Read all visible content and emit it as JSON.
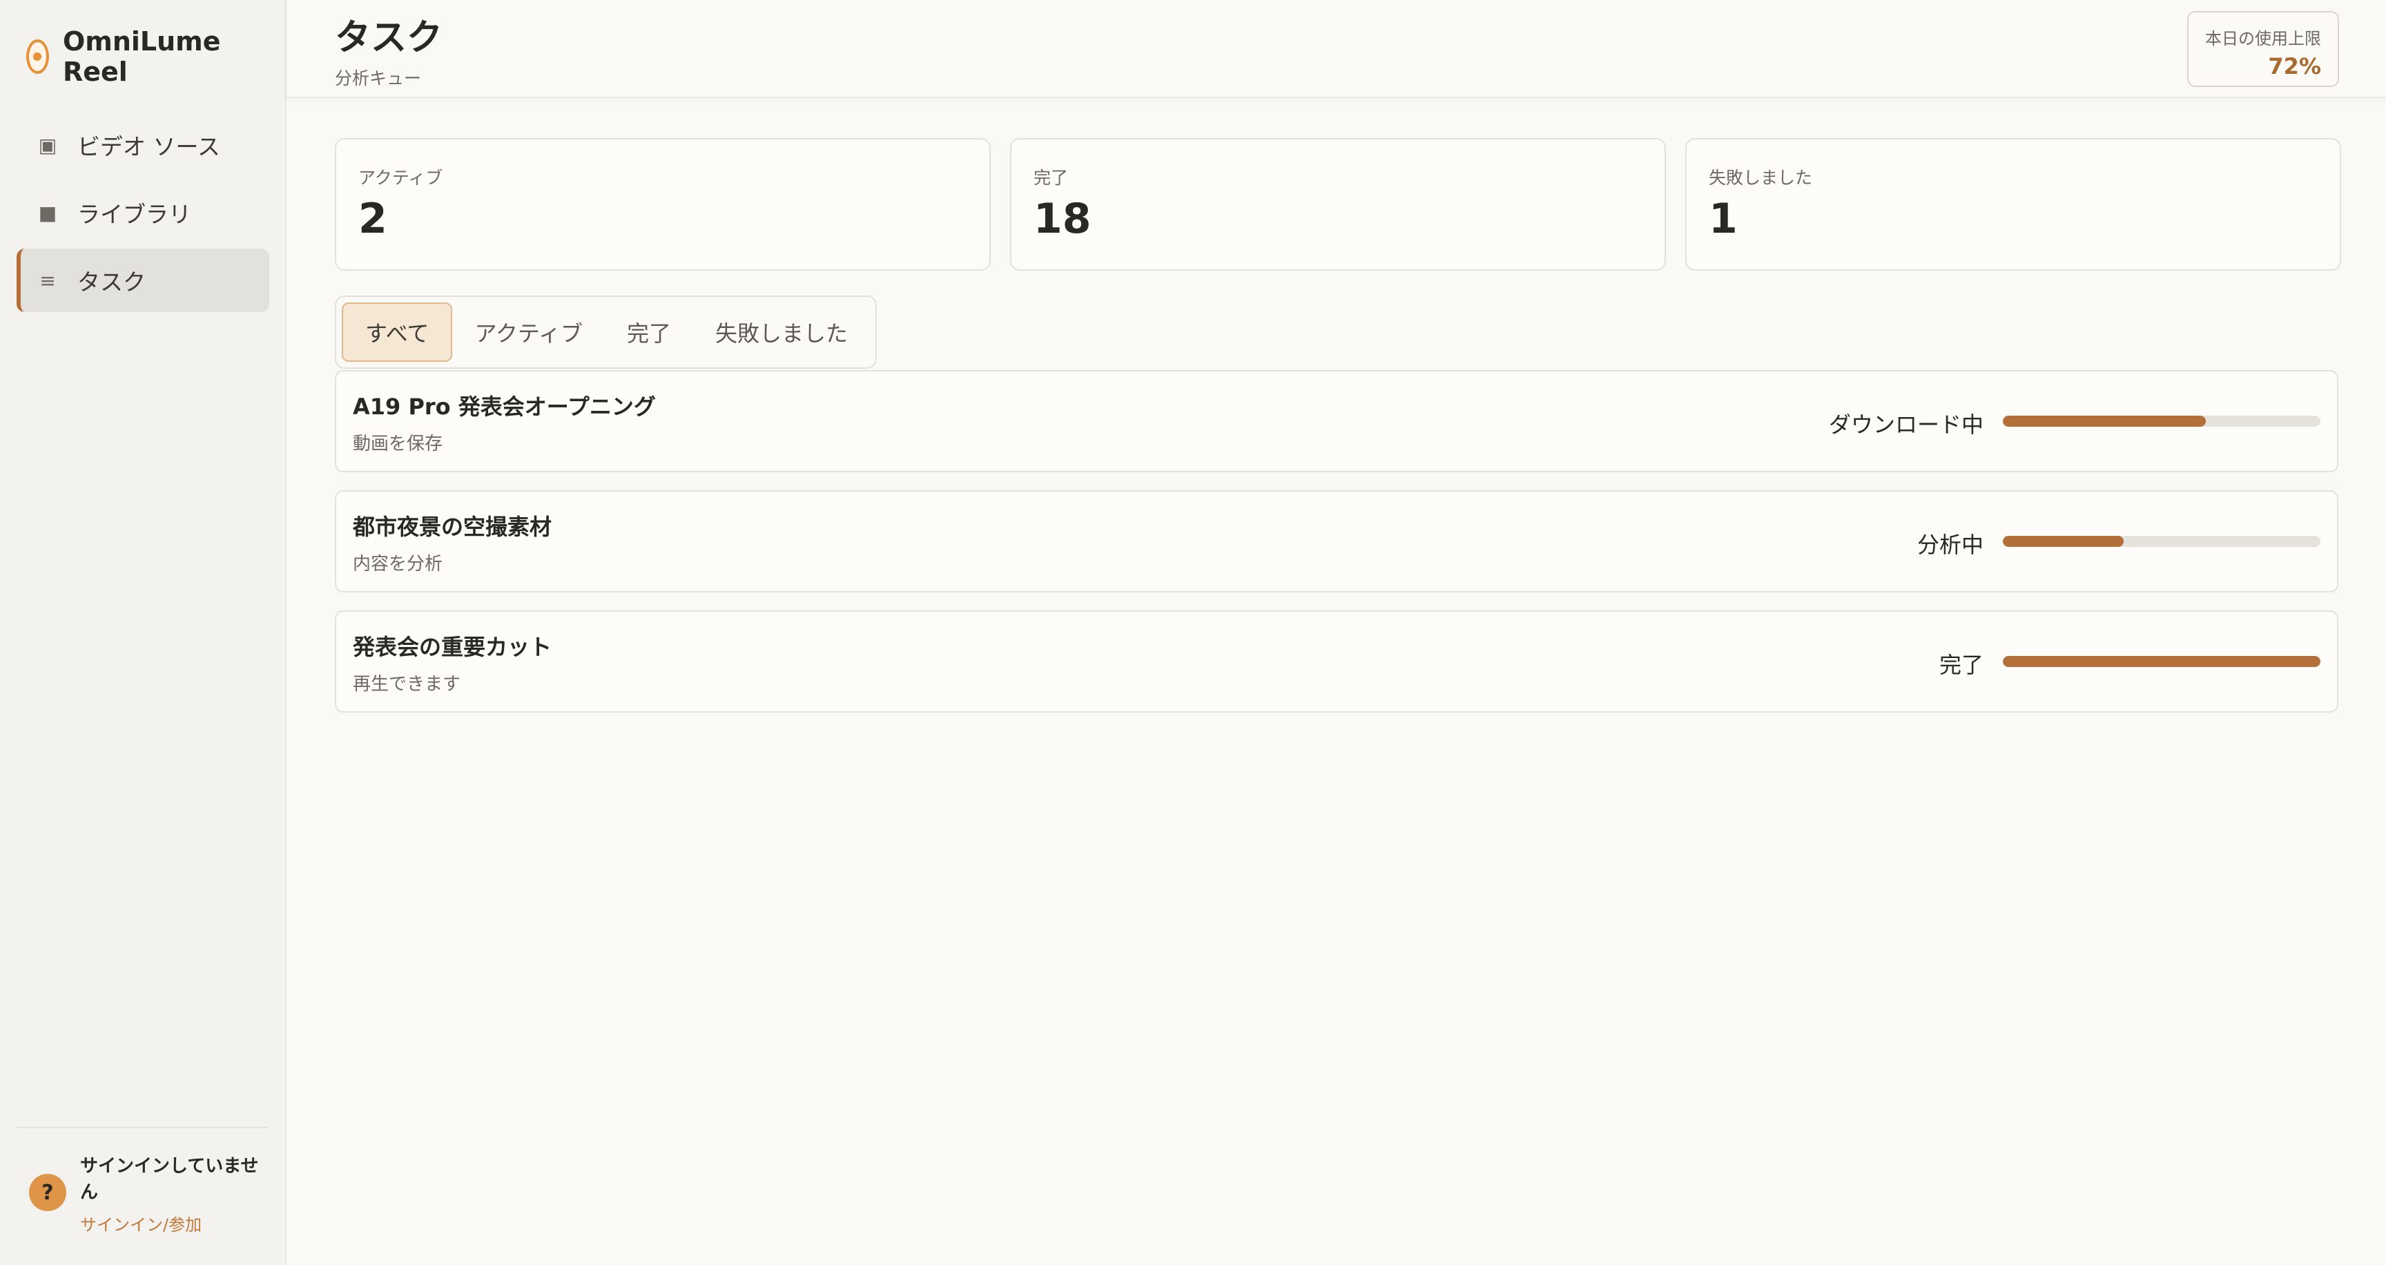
{
  "brand": {
    "name": "OmniLume Reel"
  },
  "sidebar": {
    "items": [
      {
        "label": "ビデオ ソース",
        "icon": "video-source-icon",
        "glyph": "▣"
      },
      {
        "label": "ライブラリ",
        "icon": "library-icon",
        "glyph": "■"
      },
      {
        "label": "タスク",
        "icon": "tasks-icon",
        "glyph": "≡"
      }
    ],
    "active_index": 2
  },
  "account": {
    "avatar": "?",
    "status": "サインインしていません",
    "link": "サインイン/参加"
  },
  "header": {
    "title": "タスク",
    "subtitle": "分析キュー",
    "quota_label": "本日の使用上限",
    "quota_value": "72%"
  },
  "stats": [
    {
      "label": "アクティブ",
      "value": "2"
    },
    {
      "label": "完了",
      "value": "18"
    },
    {
      "label": "失敗しました",
      "value": "1"
    }
  ],
  "tabs": [
    "すべて",
    "アクティブ",
    "完了",
    "失敗しました"
  ],
  "active_tab": 0,
  "tasks": [
    {
      "title": "A19 Pro 発表会オープニング",
      "subtitle": "動画を保存",
      "status": "ダウンロード中",
      "progress": 0.64
    },
    {
      "title": "都市夜景の空撮素材",
      "subtitle": "内容を分析",
      "status": "分析中",
      "progress": 0.38
    },
    {
      "title": "発表会の重要カット",
      "subtitle": "再生できます",
      "status": "完了",
      "progress": 1.0
    }
  ],
  "colors": {
    "accent": "#b36f3a",
    "quota": "#a86a2e",
    "link": "#c1793b",
    "avatar": "#de9548"
  }
}
